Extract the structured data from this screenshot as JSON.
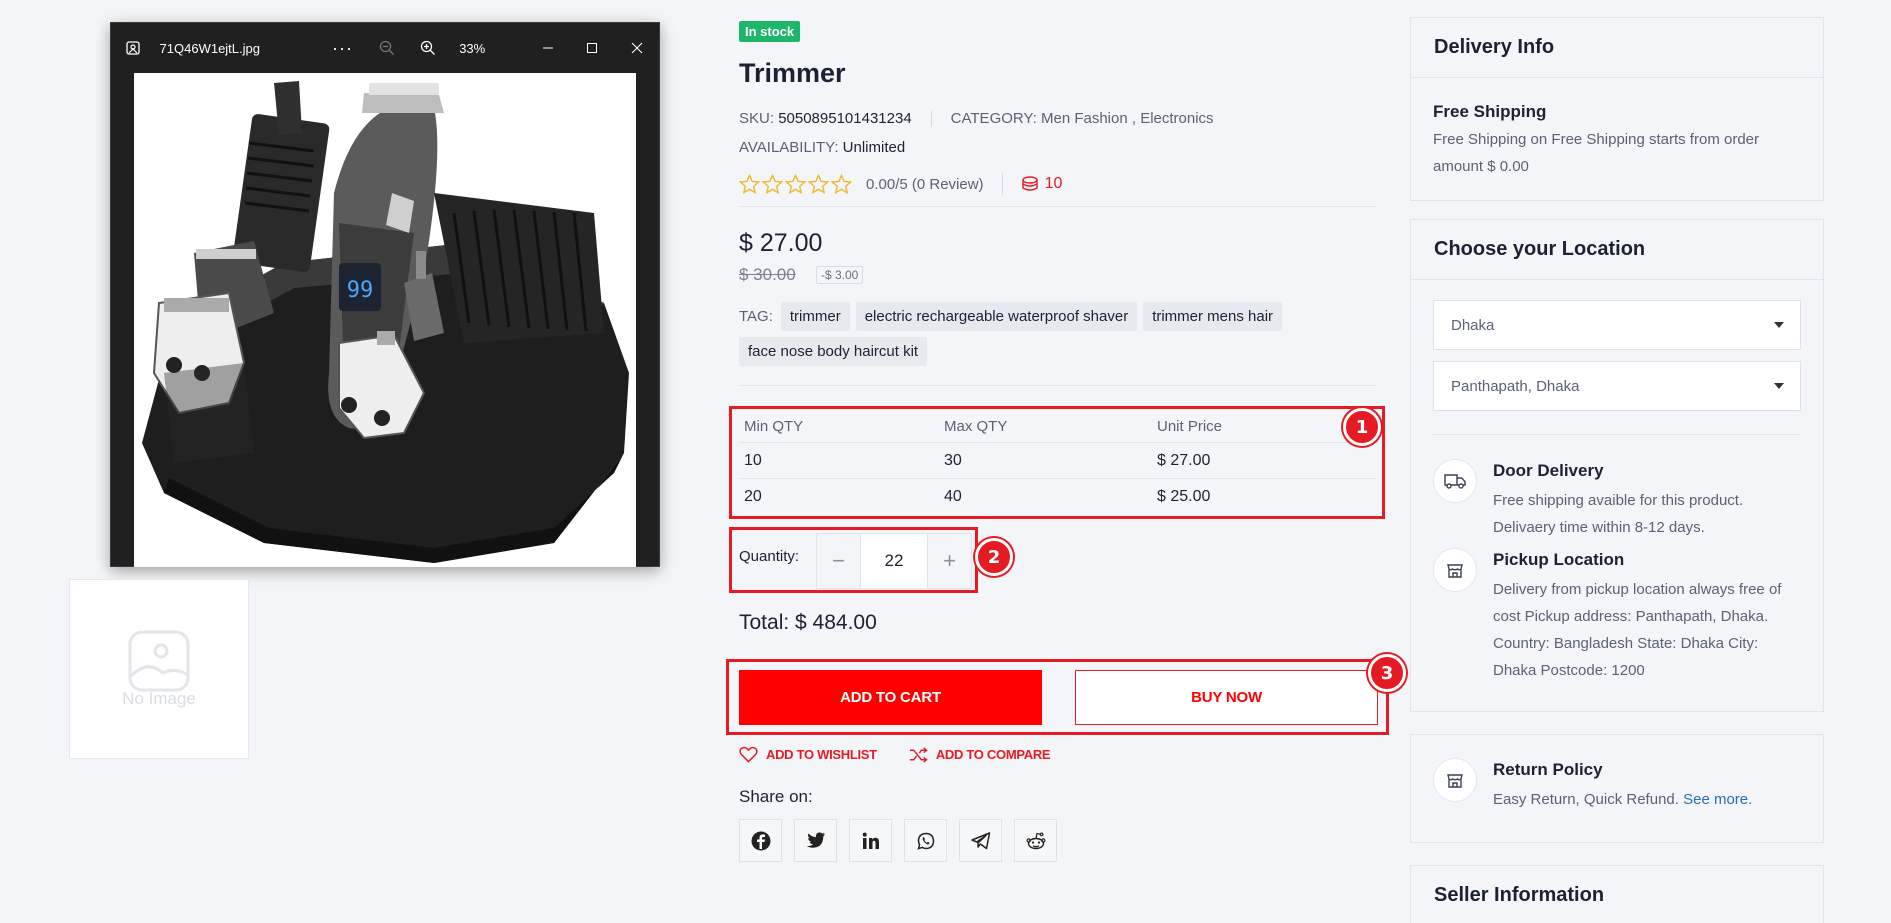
{
  "viewer": {
    "filename": "71Q46W1ejtL.jpg",
    "zoom": "33%",
    "more": "···"
  },
  "gallery": {
    "thumb_placeholder": "No Image",
    "digits": "99"
  },
  "product": {
    "stock_badge": "In stock",
    "title": "Trimmer",
    "sku_label": "SKU:",
    "sku": "5050895101431234",
    "category_label": "CATEGORY:",
    "category": "Men Fashion , Electronics",
    "availability_label": "AVAILABILITY:",
    "availability": "Unlimited",
    "rating_text": "0.00/5 (0 Review)",
    "rating": 0,
    "sold_count": "10",
    "price": "$ 27.00",
    "old_price": "$ 30.00",
    "discount": "-$ 3.00",
    "tag_label": "TAG:",
    "tags": [
      "trimmer",
      "electric rechargeable waterproof shaver",
      "trimmer mens hair",
      "face nose body haircut kit"
    ]
  },
  "qty_table": {
    "headers": [
      "Min QTY",
      "Max QTY",
      "Unit Price"
    ],
    "rows": [
      [
        "10",
        "30",
        "$ 27.00"
      ],
      [
        "20",
        "40",
        "$ 25.00"
      ]
    ]
  },
  "quantity": {
    "label": "Quantity:",
    "value": "22",
    "minus": "−",
    "plus": "+"
  },
  "total": "Total: $ 484.00",
  "actions": {
    "add_to_cart": "ADD TO CART",
    "buy_now": "BUY NOW",
    "wishlist": "ADD TO WISHLIST",
    "compare": "ADD TO COMPARE"
  },
  "share": {
    "label": "Share on:",
    "networks": [
      "facebook-icon",
      "twitter-icon",
      "linkedin-icon",
      "whatsapp-icon",
      "telegram-icon",
      "reddit-icon"
    ]
  },
  "annotations": [
    "1",
    "2",
    "3"
  ],
  "sidebar": {
    "delivery_info": {
      "title": "Delivery Info",
      "shipping_title": "Free Shipping",
      "shipping_text": "Free Shipping on Free Shipping starts from order amount $ 0.00"
    },
    "location": {
      "title": "Choose your Location",
      "city": "Dhaka",
      "area": "Panthapath, Dhaka"
    },
    "door_delivery": {
      "title": "Door Delivery",
      "text": "Free shipping avaible for this product. Delivaery time within 8-12 days."
    },
    "pickup": {
      "title": "Pickup Location",
      "text": "Delivery from pickup location always free of cost Pickup address: Panthapath, Dhaka. Country: Bangladesh State: Dhaka City: Dhaka Postcode: 1200"
    },
    "return_policy": {
      "title": "Return Policy",
      "text": "Easy Return, Quick Refund.",
      "link": "See more."
    },
    "seller": {
      "title": "Seller Information"
    }
  },
  "colors": {
    "accent": "#e51b23",
    "stock": "#1db66a",
    "star": "#f3b529"
  }
}
